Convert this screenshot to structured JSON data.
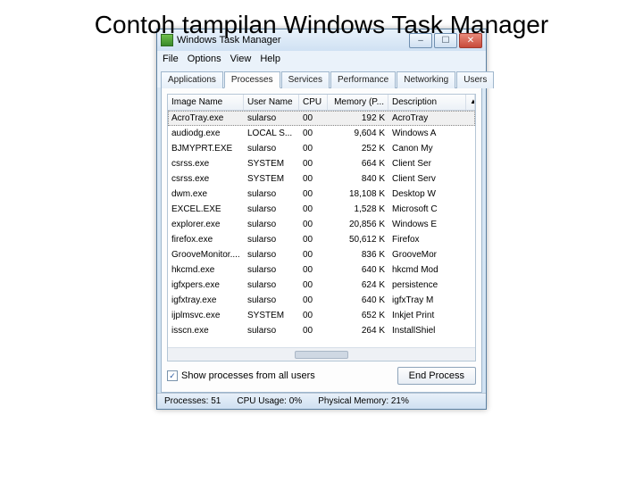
{
  "slide": {
    "title": "Contoh tampilan Windows Task Manager"
  },
  "window": {
    "title": "Windows Task Manager"
  },
  "menubar": {
    "file": "File",
    "options": "Options",
    "view": "View",
    "help": "Help"
  },
  "tabs": {
    "applications": "Applications",
    "processes": "Processes",
    "services": "Services",
    "performance": "Performance",
    "networking": "Networking",
    "users": "Users"
  },
  "columns": {
    "image_name": "Image Name",
    "user_name": "User Name",
    "cpu": "CPU",
    "memory": "Memory (P...",
    "description": "Description"
  },
  "rows": [
    {
      "image": "AcroTray.exe",
      "user": "sularso",
      "cpu": "00",
      "mem": "192 K",
      "desc": "AcroTray",
      "selected": true
    },
    {
      "image": "audiodg.exe",
      "user": "LOCAL S...",
      "cpu": "00",
      "mem": "9,604 K",
      "desc": "Windows A"
    },
    {
      "image": "BJMYPRT.EXE",
      "user": "sularso",
      "cpu": "00",
      "mem": "252 K",
      "desc": "Canon My"
    },
    {
      "image": "csrss.exe",
      "user": "SYSTEM",
      "cpu": "00",
      "mem": "664 K",
      "desc": "Client Ser"
    },
    {
      "image": "csrss.exe",
      "user": "SYSTEM",
      "cpu": "00",
      "mem": "840 K",
      "desc": "Client Serv"
    },
    {
      "image": "dwm.exe",
      "user": "sularso",
      "cpu": "00",
      "mem": "18,108 K",
      "desc": "Desktop W"
    },
    {
      "image": "EXCEL.EXE",
      "user": "sularso",
      "cpu": "00",
      "mem": "1,528 K",
      "desc": "Microsoft C"
    },
    {
      "image": "explorer.exe",
      "user": "sularso",
      "cpu": "00",
      "mem": "20,856 K",
      "desc": "Windows E"
    },
    {
      "image": "firefox.exe",
      "user": "sularso",
      "cpu": "00",
      "mem": "50,612 K",
      "desc": "Firefox"
    },
    {
      "image": "GrooveMonitor....",
      "user": "sularso",
      "cpu": "00",
      "mem": "836 K",
      "desc": "GrooveMor"
    },
    {
      "image": "hkcmd.exe",
      "user": "sularso",
      "cpu": "00",
      "mem": "640 K",
      "desc": "hkcmd Mod"
    },
    {
      "image": "igfxpers.exe",
      "user": "sularso",
      "cpu": "00",
      "mem": "624 K",
      "desc": "persistence"
    },
    {
      "image": "igfxtray.exe",
      "user": "sularso",
      "cpu": "00",
      "mem": "640 K",
      "desc": "igfxTray M"
    },
    {
      "image": "ijplmsvc.exe",
      "user": "SYSTEM",
      "cpu": "00",
      "mem": "652 K",
      "desc": "Inkjet Print"
    },
    {
      "image": "isscn.exe",
      "user": "sularso",
      "cpu": "00",
      "mem": "264 K",
      "desc": "InstallShiel"
    }
  ],
  "footer": {
    "show_all_label": "Show processes from all users",
    "end_process": "End Process"
  },
  "status": {
    "processes": "Processes: 51",
    "cpu": "CPU Usage: 0%",
    "memory": "Physical Memory: 21%"
  },
  "glyphs": {
    "min": "–",
    "max": "☐",
    "close": "✕",
    "check": "✓",
    "sort": "▲"
  }
}
